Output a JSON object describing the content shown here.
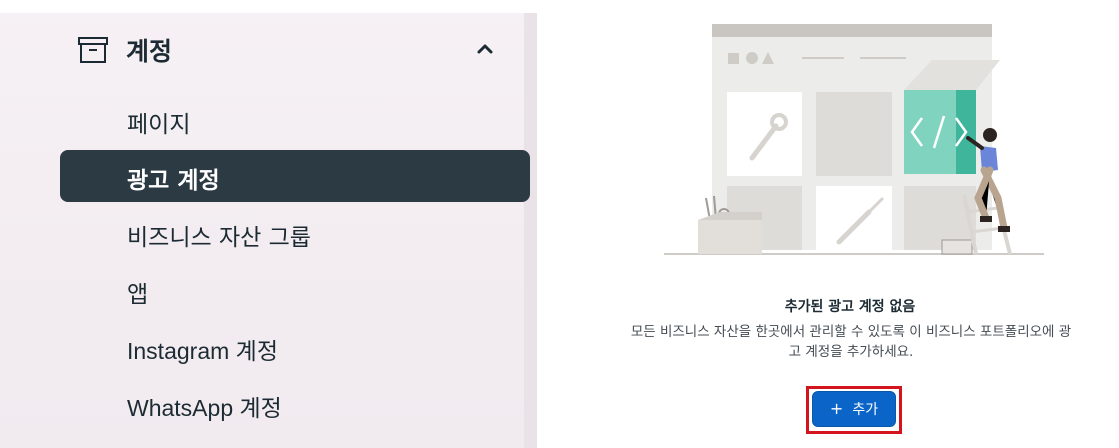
{
  "sidebar": {
    "section": {
      "icon": "archive-box-icon",
      "title": "계정",
      "toggle_icon": "chevron-up-icon"
    },
    "items": [
      {
        "label": "페이지",
        "active": false
      },
      {
        "label": "광고 계정",
        "active": true
      },
      {
        "label": "비즈니스 자산 그룹",
        "active": false
      },
      {
        "label": "앱",
        "active": false
      },
      {
        "label": "Instagram 계정",
        "active": false
      },
      {
        "label": "WhatsApp 계정",
        "active": false
      }
    ]
  },
  "empty_state": {
    "illustration": "person-building-workspace-illustration",
    "title": "추가된 광고 계정 없음",
    "description_line1": "모든 비즈니스 자산을 한곳에서 관리할 수 있도록 이 비즈니스 포트폴리오에 광",
    "description_line2": "고 계정을 추가하세요.",
    "add_button": {
      "icon": "+",
      "label": "추가"
    }
  },
  "colors": {
    "active_bg": "#2c3a44",
    "primary_button": "#0b65c9",
    "highlight": "#d4141c",
    "text": "#1c2b33"
  }
}
